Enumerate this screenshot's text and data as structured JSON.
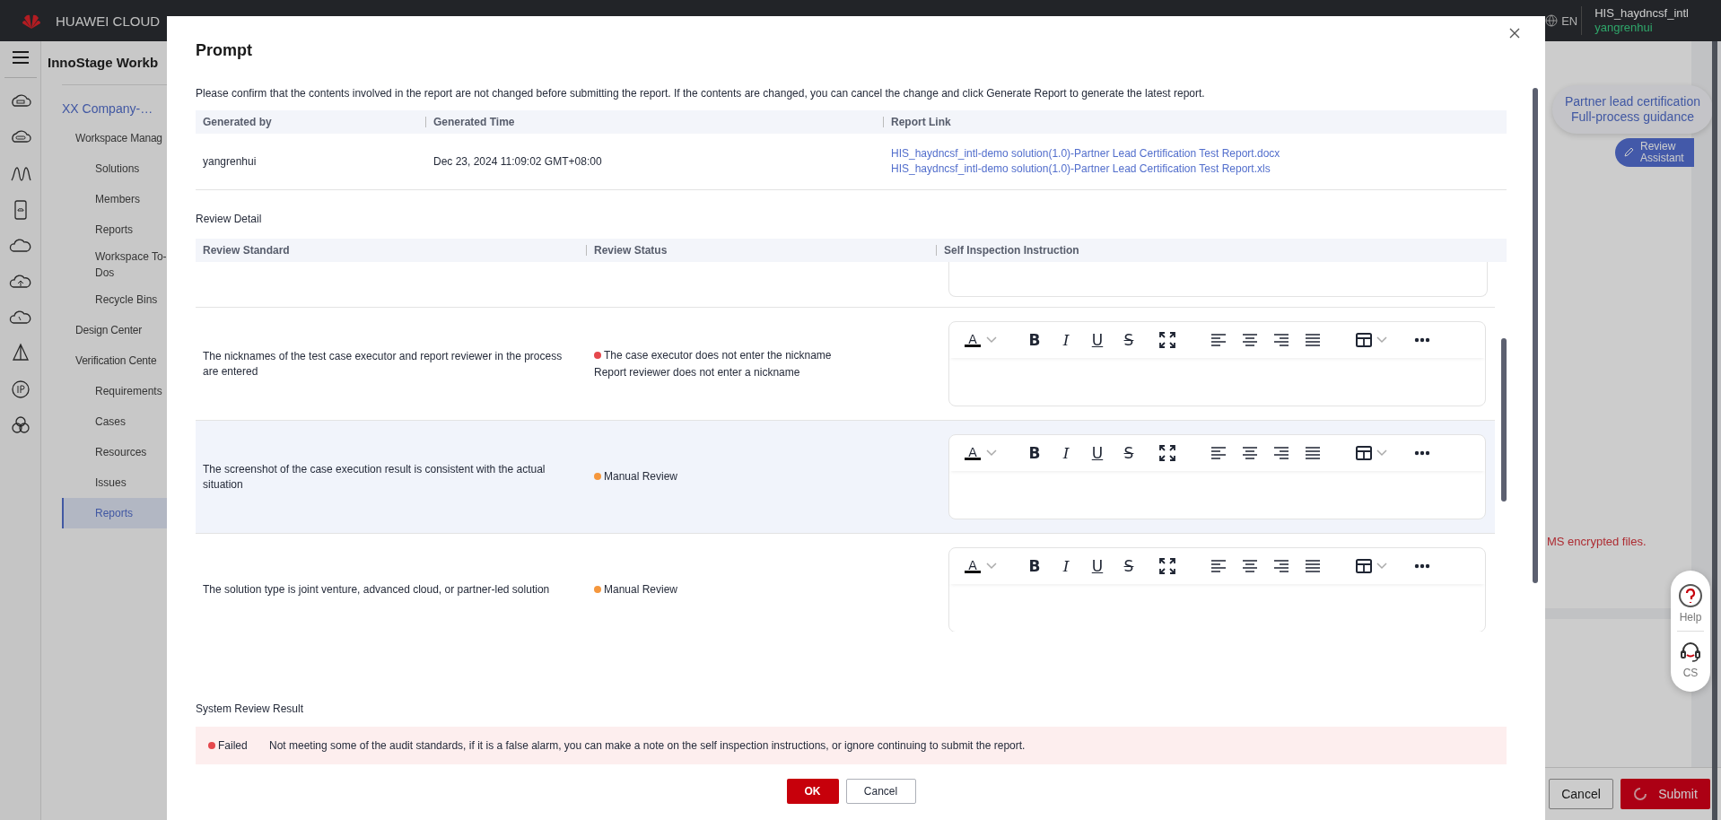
{
  "topbar": {
    "brand": "HUAWEI CLOUD",
    "language": "EN",
    "account": "HIS_haydncsf_intl",
    "user": "yangrenhui"
  },
  "nav": {
    "title": "InnoStage Workb",
    "project": "XX Company-…",
    "items": [
      {
        "label": "Workspace Manag",
        "selected": false,
        "children": [
          {
            "label": "Solutions",
            "selected": false
          },
          {
            "label": "Members",
            "selected": false
          },
          {
            "label": "Reports",
            "selected": false
          },
          {
            "label": "Workspace To-Dos",
            "selected": false
          },
          {
            "label": "Recycle Bins",
            "selected": false
          }
        ]
      },
      {
        "label": "Design Center",
        "selected": false
      },
      {
        "label": "Verification Cente",
        "selected": false,
        "children": [
          {
            "label": "Requirements",
            "selected": false
          },
          {
            "label": "Cases",
            "selected": false
          },
          {
            "label": "Resources",
            "selected": false
          },
          {
            "label": "Issues",
            "selected": false
          },
          {
            "label": "Reports",
            "selected": true
          }
        ]
      }
    ]
  },
  "background": {
    "guide_bubble": "Partner lead certification\nFull-process guidance",
    "review_assistant": "Review\nAssistant",
    "notice": "MS encrypted files.",
    "buttons": [
      {
        "label": "Cancel",
        "kind": "plain"
      },
      {
        "label": "Submit",
        "kind": "primary"
      }
    ],
    "help": [
      {
        "label": "Help",
        "kind": "help"
      },
      {
        "label": "CS",
        "kind": "cs"
      }
    ]
  },
  "dialog": {
    "title": "Prompt",
    "description": "Please confirm that the contents involved in the report are not changed before submitting the report. If the contents are changed, you can cancel the change and click Generate Report to generate the latest report.",
    "report_table": {
      "columns": [
        "Generated by",
        "Generated Time",
        "Report Link"
      ],
      "rows": [
        {
          "generated_by": "yangrenhui",
          "generated_time": "Dec 23, 2024 11:09:02 GMT+08:00",
          "links": [
            "HIS_haydncsf_intl-demo solution(1.0)-Partner Lead Certification Test Report.docx",
            "HIS_haydncsf_intl-demo solution(1.0)-Partner Lead Certification Test Report.xls"
          ]
        }
      ]
    },
    "review_detail": {
      "label": "Review Detail",
      "columns": [
        "Review Standard",
        "Review Status",
        "Self Inspection Instruction"
      ],
      "rows": [
        {
          "standard": "The nicknames of the test case executor and report reviewer in the process are entered",
          "color": "#e5484d",
          "status": [
            "The case executor does not enter the nickname",
            "Report reviewer does not enter a nickname"
          ],
          "highlighted": false,
          "tools": [
            "A",
            "B",
            "I",
            "U",
            "S"
          ]
        },
        {
          "standard": "The screenshot of the case execution result is consistent with the actual situation",
          "color": "#f5973d",
          "status": [
            "Manual Review"
          ],
          "highlighted": true,
          "tools": [
            "A",
            "B",
            "I",
            "U",
            "S"
          ]
        },
        {
          "standard": "The solution type is joint venture, advanced cloud, or partner-led solution",
          "color": "#f5973d",
          "status": [
            "Manual Review"
          ],
          "highlighted": false,
          "tools": [
            "A",
            "B",
            "I",
            "U",
            "S"
          ]
        }
      ]
    },
    "system_result": {
      "label": "System Review Result",
      "status": "Failed",
      "color": "#e5484d",
      "message": "Not meeting some of the audit standards, if it is a false alarm, you can make a note on the self inspection instructions, or ignore continuing to submit the report."
    },
    "buttons": [
      {
        "label": "OK",
        "kind": "primary"
      },
      {
        "label": "Cancel",
        "kind": "plain"
      }
    ]
  }
}
